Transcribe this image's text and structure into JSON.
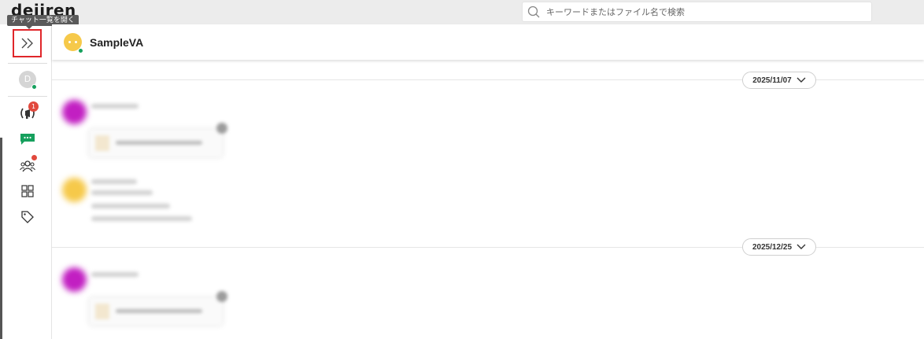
{
  "app": {
    "logo_text": "dejiren",
    "search_placeholder": "キーワードまたはファイル名で検索",
    "tooltip": "チャット一覧を開く"
  },
  "sidebar": {
    "user_initial": "D",
    "icons": [
      "broadcast-icon",
      "chat-icon",
      "group-icon",
      "apps-icon",
      "tag-icon"
    ],
    "broadcast_badge": "1"
  },
  "chat": {
    "title": "SampleVA",
    "dates": [
      "2025/11/07",
      "2025/12/25"
    ]
  },
  "colors": {
    "accent_green": "#16a05d",
    "badge_red": "#e1493d",
    "highlight_red": "#e0262a",
    "avatar_yellow": "#f6c94a",
    "avatar_magenta": "#c21fc2"
  }
}
